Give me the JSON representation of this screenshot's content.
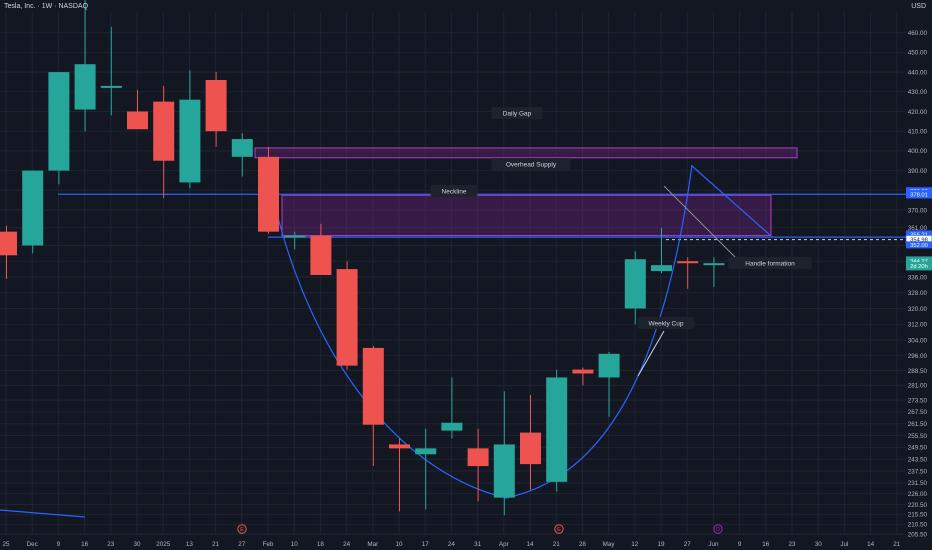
{
  "header": {
    "symbol_line": "Tesla, Inc. · 1W · NASDAQ",
    "currency": "USD"
  },
  "chart_data": {
    "type": "candlestick",
    "title": "Tesla, Inc. · 1W · NASDAQ",
    "y_axis": {
      "min": 200,
      "max": 468,
      "scale": "linear",
      "unit": "USD",
      "ticks": [
        205.5,
        210.5,
        215.5,
        220.5,
        226.0,
        231.5,
        237.5,
        243.5,
        249.5,
        255.5,
        261.5,
        267.5,
        273.5,
        281.0,
        288.5,
        296.0,
        304.0,
        312.0,
        320.0,
        328.0,
        336.0,
        344.0,
        352.0,
        361.0,
        370.0,
        380.0,
        390.0,
        400.0,
        410.0,
        420.0,
        430.0,
        440.0,
        450.0,
        460.0
      ]
    },
    "x_labels": [
      "25",
      "Dec",
      "9",
      "16",
      "23",
      "30",
      "2025",
      "13",
      "21",
      "27",
      "Feb",
      "10",
      "18",
      "24",
      "Mar",
      "10",
      "17",
      "24",
      "31",
      "Apr",
      "14",
      "21",
      "28",
      "May",
      "12",
      "19",
      "27",
      "Jun",
      "9",
      "16",
      "23",
      "30",
      "Jul",
      "14",
      "21"
    ],
    "colors": {
      "up": "#26a69a",
      "down": "#ef5350",
      "line": "#2962ff",
      "zone": "#9c27b0",
      "background": "#131722"
    },
    "grid": true,
    "candles": [
      {
        "o": 359.0,
        "h": 362.0,
        "l": 335.0,
        "c": 347.0
      },
      {
        "o": 352.0,
        "h": 378.0,
        "l": 348.0,
        "c": 390.0
      },
      {
        "o": 390.0,
        "h": 439.0,
        "l": 383.0,
        "c": 440.0
      },
      {
        "o": 421.0,
        "h": 489.0,
        "l": 410.0,
        "c": 444.0
      },
      {
        "o": 432.0,
        "h": 463.0,
        "l": 418.0,
        "c": 433.0
      },
      {
        "o": 420.0,
        "h": 431.0,
        "l": 417.0,
        "c": 411.0
      },
      {
        "o": 425.0,
        "h": 433.0,
        "l": 376.0,
        "c": 395.0
      },
      {
        "o": 384.0,
        "h": 441.0,
        "l": 381.0,
        "c": 426.0
      },
      {
        "o": 436.0,
        "h": 440.0,
        "l": 402.0,
        "c": 410.0
      },
      {
        "o": 397.0,
        "h": 409.0,
        "l": 387.0,
        "c": 406.0
      },
      {
        "o": 397.0,
        "h": 402.0,
        "l": 358.0,
        "c": 359.0
      },
      {
        "o": 357.0,
        "h": 359.0,
        "l": 350.0,
        "c": 357.0
      },
      {
        "o": 357.0,
        "h": 363.0,
        "l": 338.0,
        "c": 337.0
      },
      {
        "o": 340.0,
        "h": 344.0,
        "l": 289.0,
        "c": 291.0
      },
      {
        "o": 300.0,
        "h": 301.0,
        "l": 240.0,
        "c": 261.0
      },
      {
        "o": 251.0,
        "h": 254.0,
        "l": 217.0,
        "c": 249.0
      },
      {
        "o": 246.0,
        "h": 259.0,
        "l": 218.0,
        "c": 249.0
      },
      {
        "o": 258.0,
        "h": 285.0,
        "l": 254.0,
        "c": 262.0
      },
      {
        "o": 249.0,
        "h": 259.0,
        "l": 222.0,
        "c": 240.0
      },
      {
        "o": 224.0,
        "h": 278.0,
        "l": 215.0,
        "c": 251.0
      },
      {
        "o": 257.0,
        "h": 276.0,
        "l": 228.0,
        "c": 241.0
      },
      {
        "o": 232.0,
        "h": 289.0,
        "l": 227.0,
        "c": 285.0
      },
      {
        "o": 289.0,
        "h": 290.0,
        "l": 281.0,
        "c": 287.0
      },
      {
        "o": 285.0,
        "h": 298.0,
        "l": 265.0,
        "c": 297.0
      },
      {
        "o": 320.0,
        "h": 349.0,
        "l": 312.0,
        "c": 345.0
      },
      {
        "o": 339.0,
        "h": 361.0,
        "l": 338.0,
        "c": 342.0
      },
      {
        "o": 344.0,
        "h": 346.0,
        "l": 330.0,
        "c": 343.0
      },
      {
        "o": 342.0,
        "h": 346.0,
        "l": 331.0,
        "c": 343.0
      }
    ],
    "zones": [
      {
        "label": "Daily Gap",
        "from": 396.5,
        "to": 401.5
      },
      {
        "label": "Overhead Supply",
        "from": 357.0,
        "to": 377.5
      }
    ],
    "levels": [
      {
        "value": 378.01
      },
      {
        "value": 356.21,
        "label": "Neckline"
      },
      {
        "value": 354.98,
        "dashed": true
      }
    ],
    "price_tags": [
      {
        "text": "380.00",
        "value": 379.8,
        "bg": "#2962ff",
        "small": true
      },
      {
        "text": "378.01",
        "value": 378.01,
        "bg": "#2962ff"
      },
      {
        "text": "356.21",
        "value": 357.5,
        "bg": "#2962ff"
      },
      {
        "text": "354.98",
        "value": 354.98,
        "bg": "#ffffff",
        "fg": "#131722",
        "border": "#2962ff"
      },
      {
        "text": "352.00",
        "value": 352.3,
        "bg": "#2962ff",
        "small": true
      },
      {
        "text": "344.27",
        "value": 344.27,
        "bg": "#26a69a"
      },
      {
        "text": "2d 20h",
        "value": 341.5,
        "bg": "#26a69a"
      }
    ],
    "annotations": [
      {
        "text": "Daily Gap"
      },
      {
        "text": "Overhead Supply"
      },
      {
        "text": "Neckline"
      },
      {
        "text": "Handle formation"
      },
      {
        "text": "Weekly Cup"
      }
    ],
    "event_markers": [
      "E",
      "E",
      "D"
    ]
  }
}
